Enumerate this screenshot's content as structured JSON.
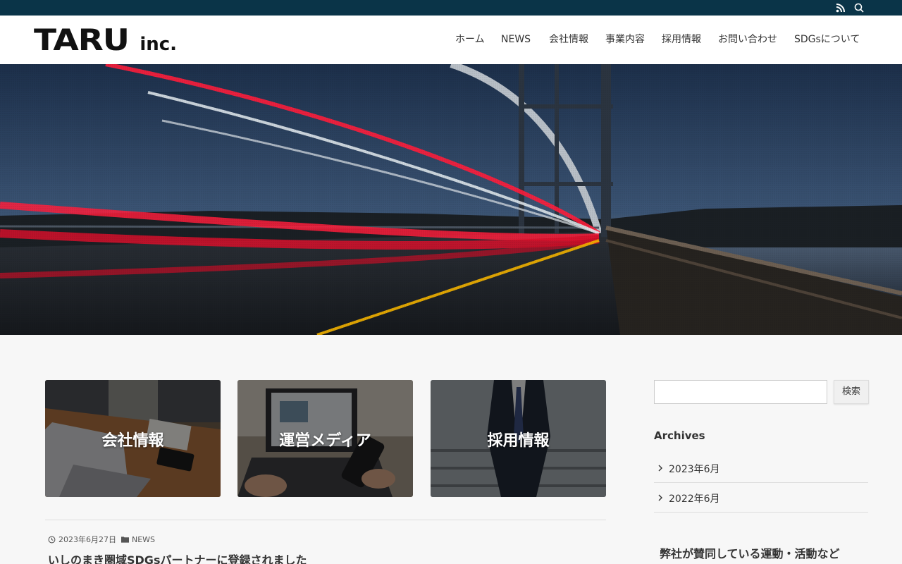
{
  "icons": {
    "rss": "rss-icon",
    "search": "search-icon",
    "clock": "clock-icon",
    "folder": "folder-icon",
    "chevron": "chevron-right-icon"
  },
  "colors": {
    "topbar": "#0a3448",
    "accent_red": "#e0122e"
  },
  "logo": {
    "main": "TARU",
    "suffix": "inc."
  },
  "nav": [
    "ホーム",
    "NEWS",
    "会社情報",
    "事業内容",
    "採用情報",
    "お問い合わせ",
    "SDGsについて"
  ],
  "cards": [
    {
      "label": "会社情報"
    },
    {
      "label": "運営メディア"
    },
    {
      "label": "採用情報"
    }
  ],
  "post": {
    "date": "2023年6月27日",
    "category": "NEWS",
    "title": "いしのまき圏域SDGsパートナーに登録されました"
  },
  "sidebar": {
    "search_button": "検索",
    "archives_title": "Archives",
    "archives": [
      "2023年6月",
      "2022年6月"
    ],
    "widget2_title": "弊社が賛同している運動・活動など"
  }
}
